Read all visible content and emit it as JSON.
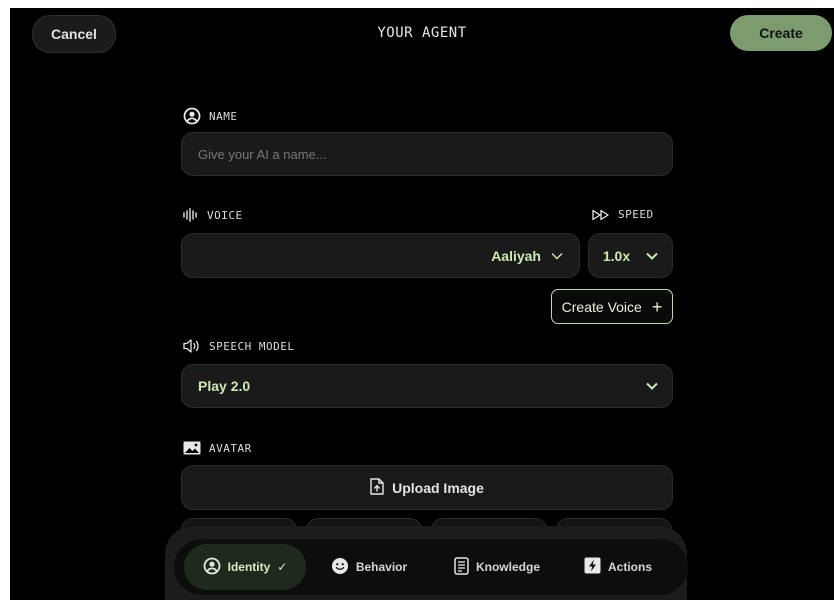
{
  "header": {
    "cancel_label": "Cancel",
    "title": "YOUR AGENT",
    "create_label": "Create"
  },
  "name": {
    "label": "NAME",
    "placeholder": "Give your AI a name..."
  },
  "voice": {
    "label": "VOICE",
    "selected": "Aaliyah",
    "speed_label": "SPEED",
    "speed_value": "1.0x",
    "create_voice_label": "Create Voice"
  },
  "speech_model": {
    "label": "SPEECH MODEL",
    "selected": "Play 2.0"
  },
  "avatar": {
    "label": "AVATAR",
    "upload_label": "Upload Image"
  },
  "tabs": [
    {
      "label": "Identity",
      "check": "✓",
      "icon": "user-circle-icon"
    },
    {
      "label": "Behavior",
      "icon": "smiley-icon"
    },
    {
      "label": "Knowledge",
      "icon": "document-icon"
    },
    {
      "label": "Actions",
      "icon": "lightning-icon"
    }
  ],
  "colors": {
    "accent_green": "#7c9b6f",
    "text_green": "#cde8b4",
    "background": "#000000"
  }
}
